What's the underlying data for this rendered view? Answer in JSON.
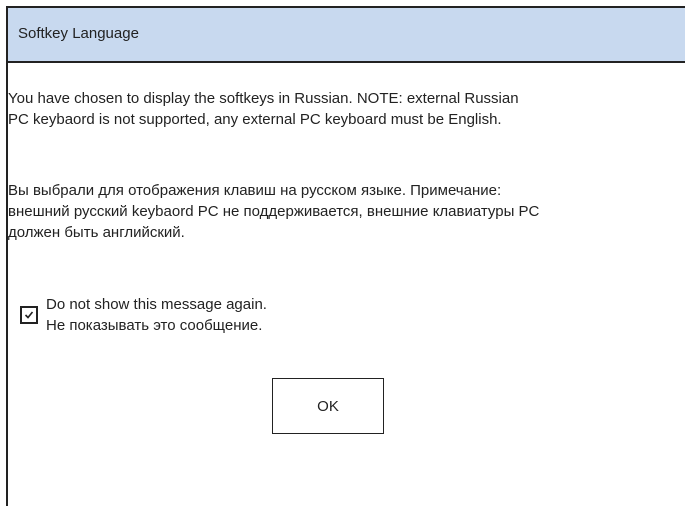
{
  "dialog": {
    "title": "Softkey Language",
    "message_en": "You have chosen to display the softkeys in Russian.  NOTE: external Russian\nPC keybaord is not supported, any external PC keyboard must be English.",
    "message_ru": "Вы выбрали для отображения клавиш на русском языке. Примечание:\nвнешний русский keybaord PC не поддерживается, внешние клавиатуры PC\nдолжен быть английский.",
    "checkbox": {
      "checked": true,
      "label": "Do not show this message again.\nНе показывать это сообщение."
    },
    "ok_label": "OK"
  },
  "colors": {
    "titlebar_bg": "#c8d9ef",
    "border": "#222222"
  }
}
